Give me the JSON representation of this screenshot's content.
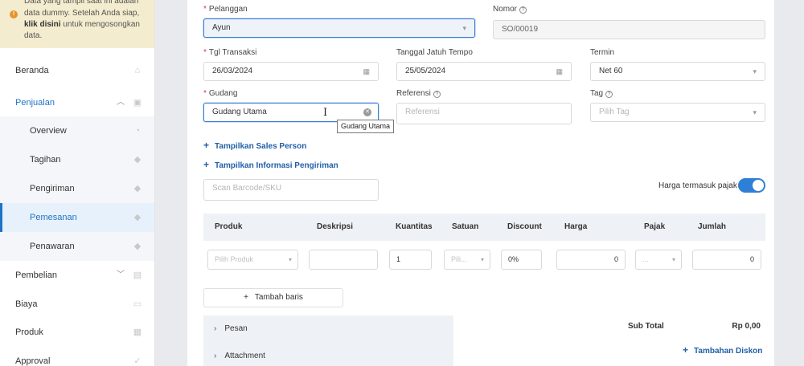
{
  "notice": {
    "line1": "Data yang tampil saat ini adalah",
    "line2": "data dummy. Setelah Anda siap,",
    "link": "klik disini",
    "line3_rest": " untuk mengosongkan",
    "line4": "data."
  },
  "sidebar": {
    "items": [
      {
        "label": "Beranda"
      },
      {
        "label": "Penjualan"
      },
      {
        "label": "Overview"
      },
      {
        "label": "Tagihan"
      },
      {
        "label": "Pengiriman"
      },
      {
        "label": "Pemesanan"
      },
      {
        "label": "Penawaran"
      },
      {
        "label": "Pembelian"
      },
      {
        "label": "Biaya"
      },
      {
        "label": "Produk"
      },
      {
        "label": "Approval"
      }
    ]
  },
  "form": {
    "pelanggan_label": "Pelanggan",
    "pelanggan_value": "Ayun",
    "nomor_label": "Nomor",
    "nomor_value": "SO/00019",
    "tgl_transaksi_label": "Tgl Transaksi",
    "tgl_transaksi_value": "26/03/2024",
    "jatuh_tempo_label": "Tanggal Jatuh Tempo",
    "jatuh_tempo_value": "25/05/2024",
    "termin_label": "Termin",
    "termin_value": "Net 60",
    "gudang_label": "Gudang",
    "gudang_value": "Gudang Utama",
    "gudang_tooltip": "Gudang Utama",
    "referensi_label": "Referensi",
    "referensi_placeholder": "Referensi",
    "tag_label": "Tag",
    "tag_placeholder": "Pilih Tag",
    "sales_person_link": "Tampilkan Sales Person",
    "pengiriman_link": "Tampilkan Informasi Pengiriman",
    "barcode_placeholder": "Scan Barcode/SKU",
    "harga_pajak_label": "Harga termasuk pajak",
    "harga_pajak_on": true
  },
  "table": {
    "headers": [
      "Produk",
      "Deskripsi",
      "Kuantitas",
      "Satuan",
      "Discount",
      "Harga",
      "Pajak",
      "Jumlah"
    ],
    "row": {
      "produk_placeholder": "Pilih Produk",
      "deskripsi": "",
      "kuantitas": "1",
      "satuan_placeholder": "Pili...",
      "discount": "0%",
      "harga": "0",
      "pajak": "...",
      "jumlah": "0"
    }
  },
  "add_row_label": "Tambah baris",
  "sections": {
    "pesan": "Pesan",
    "attachment": "Attachment"
  },
  "totals": {
    "subtotal_label": "Sub Total",
    "subtotal_value": "Rp 0,00",
    "discount_link": "Tambahan Diskon"
  }
}
